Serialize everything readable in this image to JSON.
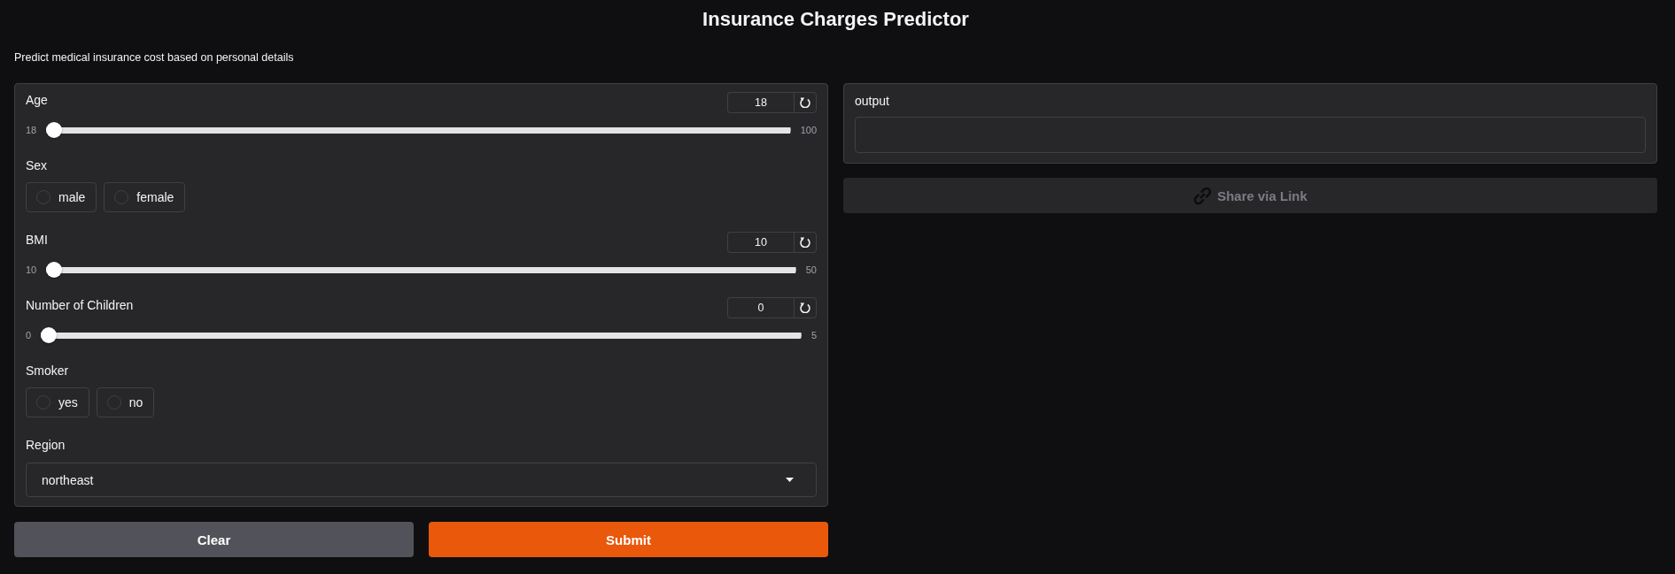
{
  "header": {
    "title": "Insurance Charges Predictor",
    "description": "Predict medical insurance cost based on personal details"
  },
  "inputs": [
    {
      "kind": "slider",
      "label": "Age",
      "value": "18",
      "min": "18",
      "max": "100",
      "level": 0
    },
    {
      "kind": "radio",
      "label": "Sex",
      "options": [
        {
          "label": "male",
          "selected": false
        },
        {
          "label": "female",
          "selected": false
        }
      ]
    },
    {
      "kind": "slider",
      "label": "BMI",
      "value": "10",
      "min": "10",
      "max": "50",
      "level": 0
    },
    {
      "kind": "slider",
      "label": "Number of Children",
      "value": "0",
      "min": "0",
      "max": "5",
      "level": 0
    },
    {
      "kind": "radio",
      "label": "Smoker",
      "options": [
        {
          "label": "yes",
          "selected": false
        },
        {
          "label": "no",
          "selected": false
        }
      ]
    },
    {
      "kind": "dropdown",
      "label": "Region",
      "value": "northeast"
    }
  ],
  "actions": [
    {
      "kind": "secondary",
      "label": "Clear"
    },
    {
      "kind": "primary",
      "label": "Submit"
    }
  ],
  "output": {
    "label": "output"
  },
  "share_button": {
    "label": "Share via Link",
    "disabled": true
  }
}
